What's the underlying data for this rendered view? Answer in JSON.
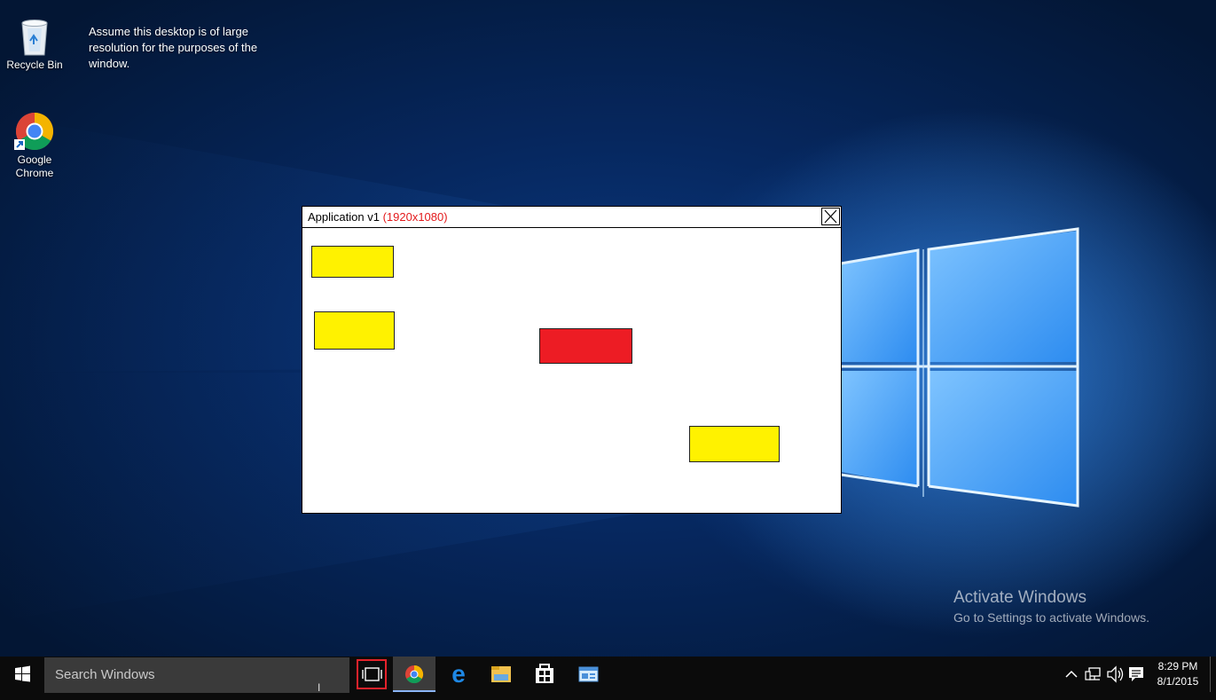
{
  "desktop": {
    "icons": [
      {
        "label": "Recycle Bin",
        "icon": "recycle-bin-icon"
      },
      {
        "label_line1": "Google",
        "label_line2": "Chrome",
        "icon": "chrome-icon"
      }
    ],
    "note": "Assume this desktop is of large resolution for the purposes of the window.",
    "watermark": {
      "title": "Activate Windows",
      "subtitle": "Go to Settings to activate Windows."
    }
  },
  "app_window": {
    "title": "Application v1",
    "resolution": "(1920x1080)",
    "resolution_color": "#e31a1c",
    "close_icon": "close-x-icon",
    "blocks": [
      {
        "name": "yellow-block-1",
        "color": "#fff200"
      },
      {
        "name": "yellow-block-2",
        "color": "#fff200"
      },
      {
        "name": "red-block",
        "color": "#ed1c24"
      },
      {
        "name": "yellow-block-3",
        "color": "#fff200"
      }
    ]
  },
  "taskbar": {
    "start_icon": "windows-logo-icon",
    "search_placeholder": "Search Windows",
    "task_view_icon": "task-view-icon",
    "pinned": [
      "chrome-icon",
      "edge-icon",
      "file-explorer-icon",
      "store-icon",
      "app-window-icon"
    ],
    "tray_icons": [
      "chevron-up-icon",
      "network-icon",
      "volume-icon",
      "action-center-icon"
    ],
    "time": "8:29 PM",
    "date": "8/1/2015"
  }
}
